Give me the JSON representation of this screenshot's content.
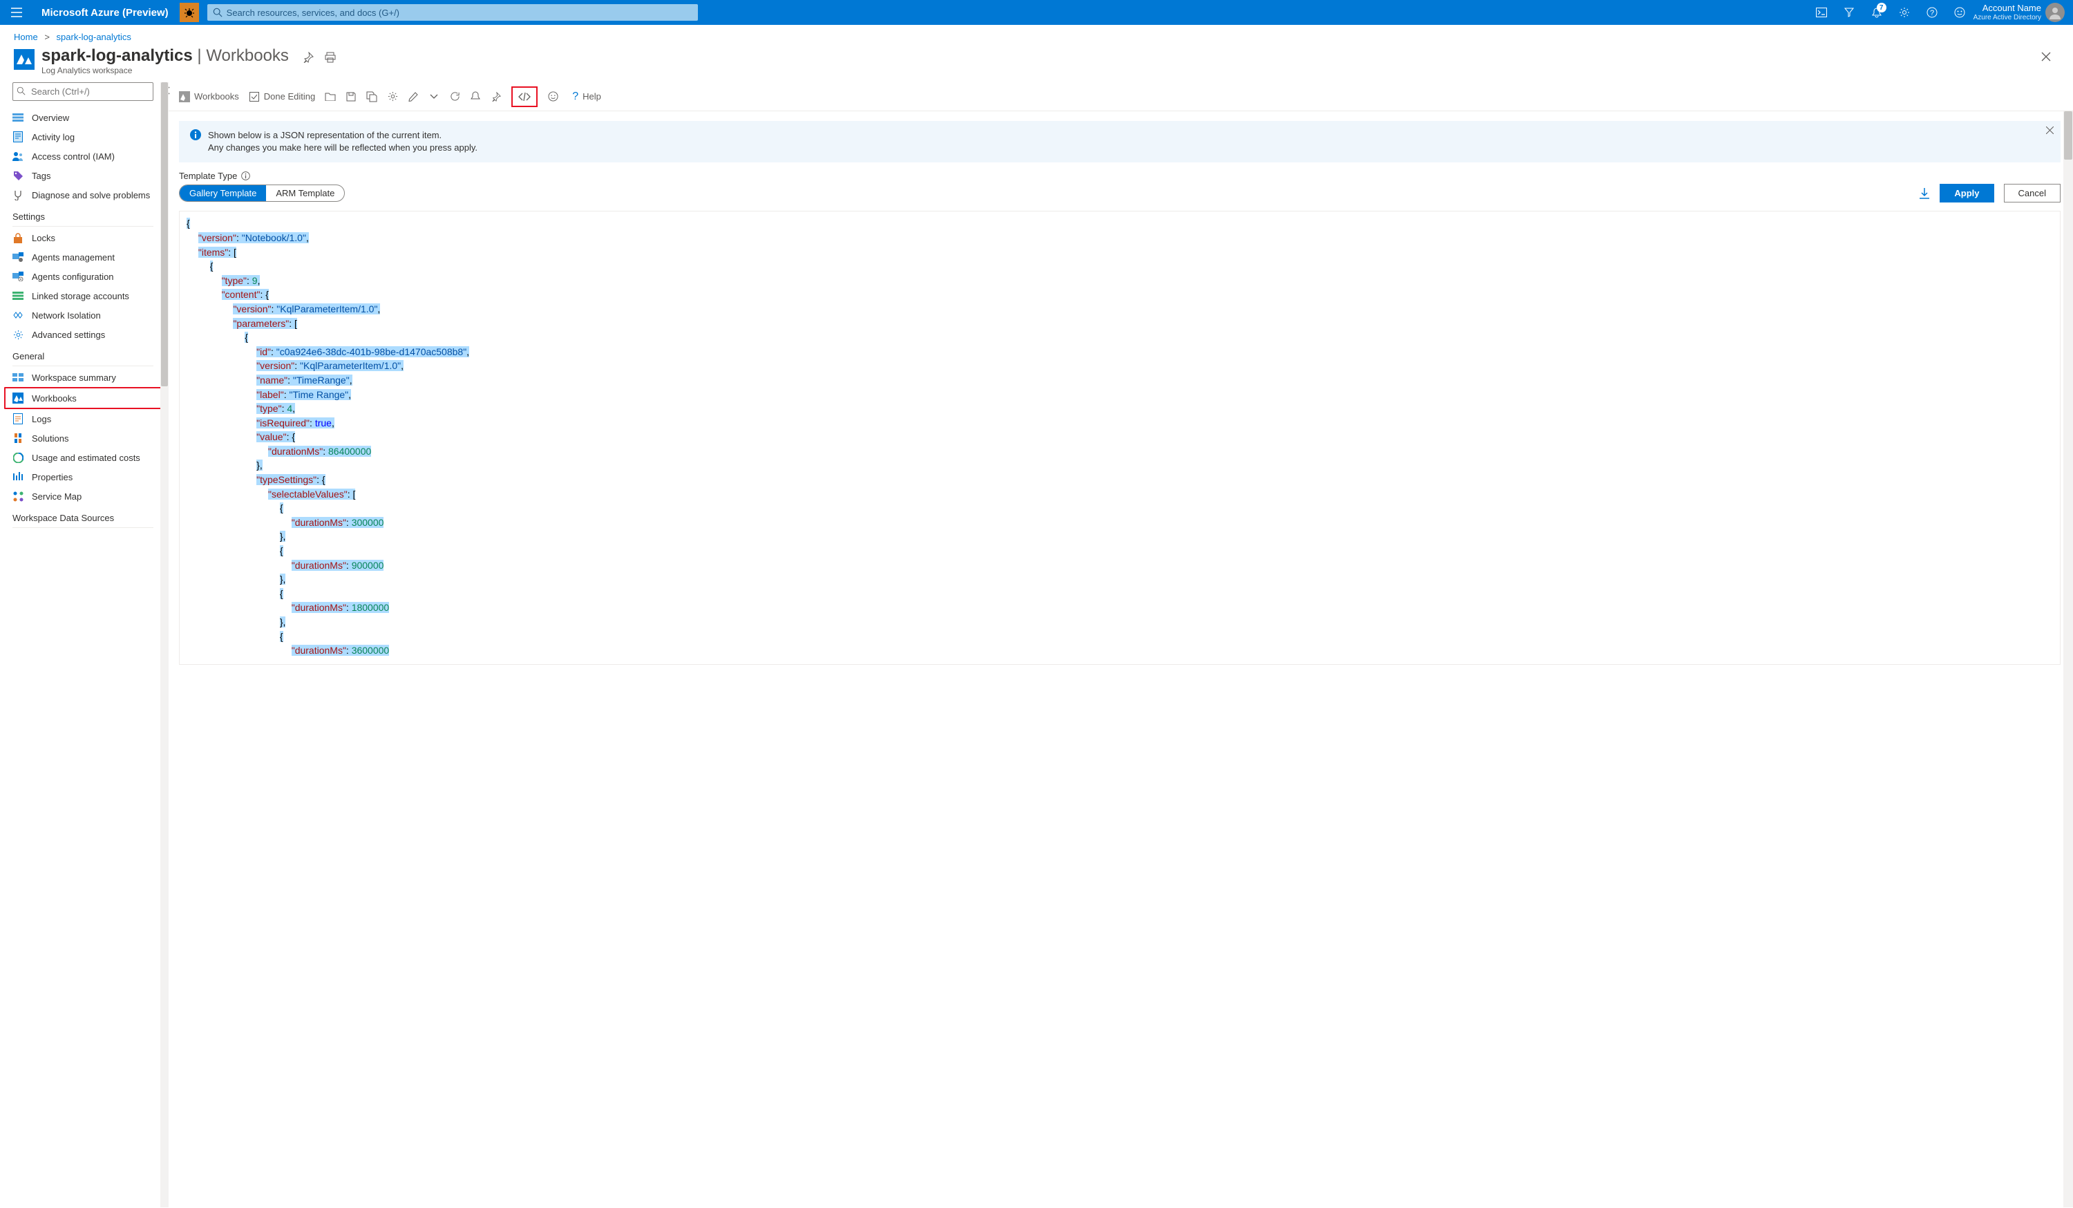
{
  "header": {
    "logo": "Microsoft Azure (Preview)",
    "search_placeholder": "Search resources, services, and docs (G+/)",
    "notification_count": "7",
    "account_name": "Account Name",
    "directory": "Azure Active Directory"
  },
  "breadcrumb": {
    "home": "Home",
    "current": "spark-log-analytics"
  },
  "title": {
    "resource": "spark-log-analytics",
    "page": "Workbooks",
    "subtype": "Log Analytics workspace"
  },
  "sidebar": {
    "search_placeholder": "Search (Ctrl+/)",
    "items": [
      {
        "label": "Overview"
      },
      {
        "label": "Activity log"
      },
      {
        "label": "Access control (IAM)"
      },
      {
        "label": "Tags"
      },
      {
        "label": "Diagnose and solve problems"
      }
    ],
    "settings_label": "Settings",
    "settings": [
      {
        "label": "Locks"
      },
      {
        "label": "Agents management"
      },
      {
        "label": "Agents configuration"
      },
      {
        "label": "Linked storage accounts"
      },
      {
        "label": "Network Isolation"
      },
      {
        "label": "Advanced settings"
      }
    ],
    "general_label": "General",
    "general": [
      {
        "label": "Workspace summary"
      },
      {
        "label": "Workbooks"
      },
      {
        "label": "Logs"
      },
      {
        "label": "Solutions"
      },
      {
        "label": "Usage and estimated costs"
      },
      {
        "label": "Properties"
      },
      {
        "label": "Service Map"
      }
    ],
    "ds_label": "Workspace Data Sources"
  },
  "toolbar": {
    "workbooks": "Workbooks",
    "done_editing": "Done Editing",
    "help": "Help"
  },
  "banner": {
    "line1": "Shown below is a JSON representation of the current item.",
    "line2": "Any changes you make here will be reflected when you press apply."
  },
  "template": {
    "label": "Template Type",
    "gallery": "Gallery Template",
    "arm": "ARM Template",
    "apply": "Apply",
    "cancel": "Cancel"
  },
  "json": {
    "version_k": "\"version\"",
    "version_v": "\"Notebook/1.0\"",
    "items_k": "\"items\"",
    "type_k": "\"type\"",
    "type_v": "9",
    "content_k": "\"content\"",
    "cversion_k": "\"version\"",
    "cversion_v": "\"KqlParameterItem/1.0\"",
    "params_k": "\"parameters\"",
    "id_k": "\"id\"",
    "id_v": "\"c0a924e6-38dc-401b-98be-d1470ac508b8\"",
    "pver_k": "\"version\"",
    "pver_v": "\"KqlParameterItem/1.0\"",
    "name_k": "\"name\"",
    "name_v": "\"TimeRange\"",
    "label_k": "\"label\"",
    "label_v": "\"Time Range\"",
    "ptype_k": "\"type\"",
    "ptype_v": "4",
    "req_k": "\"isRequired\"",
    "req_v": "true",
    "val_k": "\"value\"",
    "dur_k": "\"durationMs\"",
    "dur_v": "86400000",
    "ts_k": "\"typeSettings\"",
    "sel_k": "\"selectableValues\"",
    "d1": "300000",
    "d2": "900000",
    "d3": "1800000",
    "d4": "3600000"
  }
}
